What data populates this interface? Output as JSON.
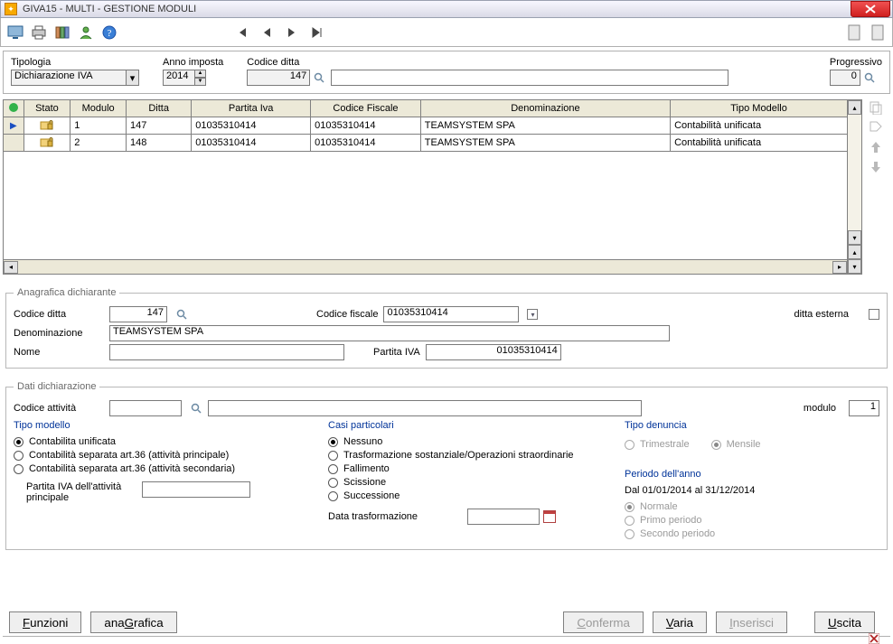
{
  "window": {
    "title": "GIVA15  - MULTI -  GESTIONE MODULI"
  },
  "filters": {
    "tipologia_label": "Tipologia",
    "tipologia_value": "Dichiarazione IVA",
    "anno_label": "Anno imposta",
    "anno_value": "2014",
    "codice_ditta_label": "Codice ditta",
    "codice_ditta_value": "147",
    "progressivo_label": "Progressivo",
    "progressivo_value": "0"
  },
  "grid": {
    "headers": {
      "stato": "Stato",
      "modulo": "Modulo",
      "ditta": "Ditta",
      "piva": "Partita Iva",
      "cf": "Codice Fiscale",
      "den": "Denominazione",
      "tipo": "Tipo Modello"
    },
    "rows": [
      {
        "modulo": "1",
        "ditta": "147",
        "piva": "01035310414",
        "cf": "01035310414",
        "den": "TEAMSYSTEM SPA",
        "tipo": "Contabilità unificata"
      },
      {
        "modulo": "2",
        "ditta": "148",
        "piva": "01035310414",
        "cf": "01035310414",
        "den": "TEAMSYSTEM SPA",
        "tipo": "Contabilità unificata"
      }
    ]
  },
  "anag": {
    "legend": "Anagrafica dichiarante",
    "codice_ditta_label": "Codice ditta",
    "codice_ditta_value": "147",
    "codice_fiscale_label": "Codice fiscale",
    "codice_fiscale_value": "01035310414",
    "ditta_esterna_label": "ditta esterna",
    "den_label": "Denominazione",
    "den_value": "TEAMSYSTEM SPA",
    "nome_label": "Nome",
    "nome_value": "",
    "piva_label": "Partita IVA",
    "piva_value": "01035310414"
  },
  "dati": {
    "legend": "Dati dichiarazione",
    "codice_attivita_label": "Codice attività",
    "codice_attivita_value": "",
    "modulo_label": "modulo",
    "modulo_value": "1",
    "tipo_modello_title": "Tipo modello",
    "tm_opts": {
      "unificata": "Contabilita unificata",
      "sep_princ": "Contabilità separata art.36 (attività principale)",
      "sep_sec": "Contabilità separata art.36 (attività secondaria)"
    },
    "piva_attivita_label": "Partita IVA dell'attività principale",
    "piva_attivita_value": "",
    "casi_title": "Casi particolari",
    "casi_opts": {
      "nessuno": "Nessuno",
      "trasf": "Trasformazione sostanziale/Operazioni straordinarie",
      "fall": "Fallimento",
      "sciss": "Scissione",
      "succ": "Successione"
    },
    "data_trasf_label": "Data trasformazione",
    "data_trasf_value": "",
    "tipo_denuncia_title": "Tipo denuncia",
    "td_opts": {
      "trim": "Trimestrale",
      "mens": "Mensile"
    },
    "periodo_title": "Periodo dell'anno",
    "periodo_text": "Dal 01/01/2014 al 31/12/2014",
    "periodo_opts": {
      "norm": "Normale",
      "primo": "Primo periodo",
      "secondo": "Secondo periodo"
    }
  },
  "buttons": {
    "funzioni": "Funzioni",
    "anagrafica": "anaGrafica",
    "conferma": "Conferma",
    "varia": "Varia",
    "inserisci": "Inserisci",
    "uscita": "Uscita"
  }
}
